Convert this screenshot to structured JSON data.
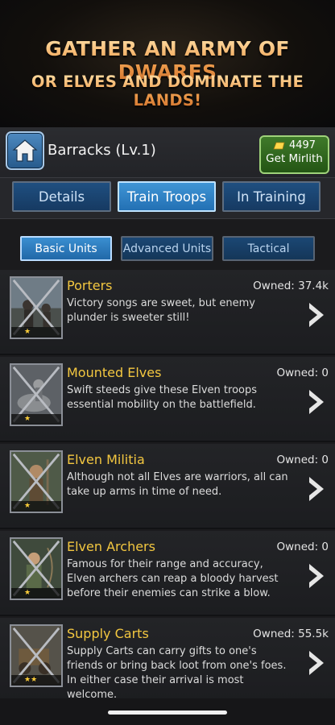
{
  "banner": {
    "line1": "GATHER AN ARMY OF DWARFS",
    "line2": "OR ELVES AND DOMINATE THE LANDS!"
  },
  "header": {
    "home_icon": "home-icon",
    "title": "Barracks (Lv.1)",
    "mirlith": {
      "count": "4497",
      "label": "Get Mirlith",
      "icon": "gold-bar-icon"
    }
  },
  "tabs": [
    {
      "label": "Details",
      "active": false
    },
    {
      "label": "Train Troops",
      "active": true
    },
    {
      "label": "In Training",
      "active": false
    }
  ],
  "subtabs": [
    {
      "label": "Basic Units",
      "active": true
    },
    {
      "label": "Advanced Units",
      "active": false
    },
    {
      "label": "Tactical",
      "active": false
    }
  ],
  "units": [
    {
      "name": "Porters",
      "owned": "Owned: 37.4k",
      "stars": "★",
      "description": "Victory songs are sweet, but enemy plunder is sweeter still!"
    },
    {
      "name": "Mounted Elves",
      "owned": "Owned: 0",
      "stars": "★",
      "description": "Swift steeds give these Elven troops essential mobility on the battlefield."
    },
    {
      "name": "Elven Militia",
      "owned": "Owned: 0",
      "stars": "★",
      "description": "Although not all Elves are warriors, all can take up arms in time of need."
    },
    {
      "name": "Elven Archers",
      "owned": "Owned: 0",
      "stars": "★",
      "description": "Famous for their range and accuracy, Elven archers can reap a bloody harvest before their enemies can strike a blow."
    },
    {
      "name": "Supply Carts",
      "owned": "Owned: 55.5k",
      "stars": "★★",
      "description": "Supply Carts can carry gifts to one's friends or bring back loot from one's foes. In either case their arrival is most welcome."
    }
  ],
  "colors": {
    "accent_gold": "#f3c740",
    "tab_blue": "#2370b4",
    "mirlith_green": "#3f7a2a"
  }
}
